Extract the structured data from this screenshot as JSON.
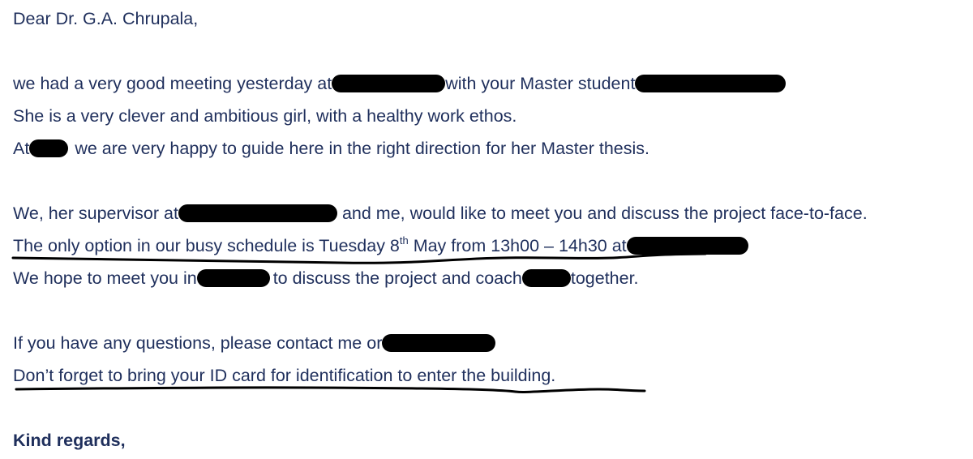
{
  "letter": {
    "greeting": "Dear Dr. G.A. Chrupala,",
    "p1_l1_a": "we had a very good meeting yesterday at",
    "p1_l1_b": "with your Master student",
    "p1_l2": "She is a very clever and ambitious girl, with a healthy work ethos.",
    "p1_l3_a": "At",
    "p1_l3_b": "we are very happy to guide here in the right direction for her Master thesis.",
    "p2_l1_a": "We, her supervisor at",
    "p2_l1_b": "and me, would like to meet you and discuss the project face-to-face.",
    "p2_l2_a": "The only option in our busy schedule is Tuesday 8",
    "p2_l2_sup": "th",
    "p2_l2_b": " May from 13h00 – 14h30 at",
    "p2_l3_a": "We hope to meet you in",
    "p2_l3_b": "to discuss the project and coach",
    "p2_l3_c": "together.",
    "p3_l1_a": "If you have any questions, please contact me or",
    "p3_l2": "Don’t forget to bring your ID card for identification to enter the building.",
    "closing": "Kind regards,"
  },
  "colors": {
    "text": "#1f2f5c",
    "redaction": "#000000",
    "pen_underline": "#000000"
  }
}
